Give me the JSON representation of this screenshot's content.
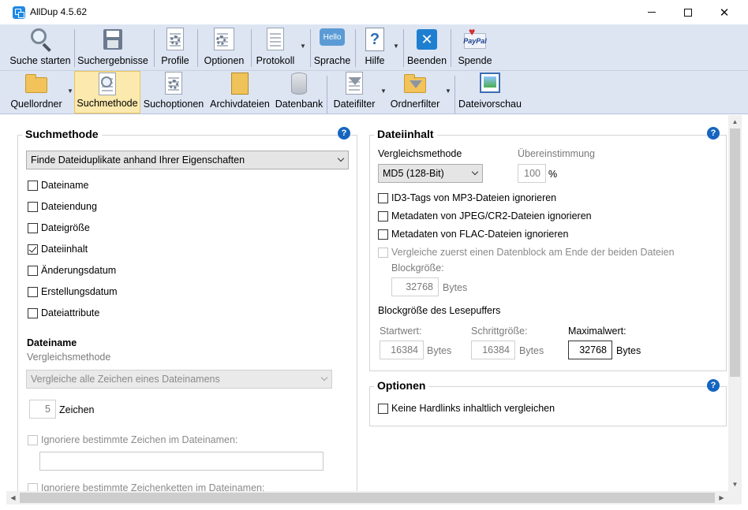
{
  "window": {
    "title": "AllDup 4.5.62"
  },
  "toolbar_main": [
    {
      "label": "Suche starten",
      "icon": "magnifier-icon"
    },
    {
      "label": "Suchergebnisse",
      "icon": "results-save-icon"
    },
    {
      "label": "Profile",
      "icon": "profile-icon"
    },
    {
      "label": "Optionen",
      "icon": "options-icon"
    },
    {
      "label": "Protokoll",
      "icon": "log-icon"
    },
    {
      "label": "Sprache",
      "icon": "language-hello-icon",
      "icon_text": "Hello"
    },
    {
      "label": "Hilfe",
      "icon": "help-icon"
    },
    {
      "label": "Beenden",
      "icon": "exit-icon"
    },
    {
      "label": "Spende",
      "icon": "paypal-donate-icon",
      "icon_text": "PayPal"
    }
  ],
  "toolbar_secondary": [
    {
      "label": "Quellordner",
      "icon": "source-folder-icon"
    },
    {
      "label": "Suchmethode",
      "icon": "search-method-icon",
      "selected": true
    },
    {
      "label": "Suchoptionen",
      "icon": "search-options-icon"
    },
    {
      "label": "Archivdateien",
      "icon": "archive-files-icon"
    },
    {
      "label": "Datenbank",
      "icon": "database-icon"
    },
    {
      "label": "Dateifilter",
      "icon": "file-filter-icon"
    },
    {
      "label": "Ordnerfilter",
      "icon": "folder-filter-icon"
    },
    {
      "label": "Dateivorschau",
      "icon": "file-preview-icon"
    }
  ],
  "suchmethode": {
    "title": "Suchmethode",
    "method_select": "Finde Dateiduplikate anhand Ihrer Eigenschaften",
    "checkboxes": [
      {
        "label": "Dateiname",
        "checked": false
      },
      {
        "label": "Dateiendung",
        "checked": false
      },
      {
        "label": "Dateigröße",
        "checked": false
      },
      {
        "label": "Dateiinhalt",
        "checked": true
      },
      {
        "label": "Änderungsdatum",
        "checked": false
      },
      {
        "label": "Erstellungsdatum",
        "checked": false
      },
      {
        "label": "Dateiattribute",
        "checked": false
      }
    ],
    "dateiname_heading": "Dateiname",
    "vergleichsmethode_label": "Vergleichsmethode",
    "dateiname_select": "Vergleiche alle Zeichen eines Dateinamens",
    "zeichen_value": "5",
    "zeichen_label": "Zeichen",
    "ignore_chars_label": "Ignoriere bestimmte Zeichen im Dateinamen:",
    "ignore_strings_label": "Ignoriere bestimmte Zeichenketten im Dateinamen:"
  },
  "dateiinhalt": {
    "title": "Dateiinhalt",
    "vergleichsmethode_label": "Vergleichsmethode",
    "method_select": "MD5 (128-Bit)",
    "uebereinstimmung_label": "Übereinstimmung",
    "uebereinstimmung_value": "100",
    "percent": "%",
    "checkboxes": [
      {
        "label": "ID3-Tags von MP3-Dateien ignorieren",
        "checked": false
      },
      {
        "label": "Metadaten von JPEG/CR2-Dateien ignorieren",
        "checked": false
      },
      {
        "label": "Metadaten von FLAC-Dateien ignorieren",
        "checked": false
      }
    ],
    "datenblock_label": "Vergleiche zuerst einen Datenblock am Ende der beiden Dateien",
    "blockgroesse_label": "Blockgröße:",
    "blockgroesse_value": "32768",
    "bytes": "Bytes",
    "lesepuffer_label": "Blockgröße des Lesepuffers",
    "startwert_label": "Startwert:",
    "startwert_value": "16384",
    "schrittgroesse_label": "Schrittgröße:",
    "schrittgroesse_value": "16384",
    "maximalwert_label": "Maximalwert:",
    "maximalwert_value": "32768"
  },
  "optionen": {
    "title": "Optionen",
    "hardlinks_label": "Keine Hardlinks inhaltlich vergleichen",
    "hardlinks_checked": false
  },
  "help_glyph": "?"
}
